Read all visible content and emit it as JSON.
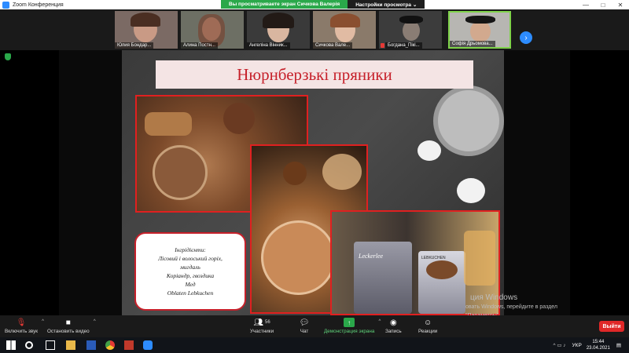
{
  "window": {
    "title": "Zoom Конференция",
    "minimize": "—",
    "maximize": "□",
    "close": "✕"
  },
  "share_banner": {
    "message": "Вы просматриваете экран Сичкова Валерія",
    "options_label": "Настройки просмотра ⌄"
  },
  "participants": [
    {
      "name": "Юлия Бондар..."
    },
    {
      "name": "Алина Постн..."
    },
    {
      "name": "Ангеліна Вінник..."
    },
    {
      "name": "Сичкова Вале..."
    },
    {
      "name": "Богдана_Пікі..."
    },
    {
      "name": "Софія Дрьомова..."
    }
  ],
  "slide": {
    "title": "Нюрнберзькі пряники",
    "ingredients": [
      "Інгрідієнти:",
      "Лісовий і волоський горіх,",
      "мигдаль",
      "Коріандр, гвоздика",
      "Мед",
      "Oblaten Lebkuchen"
    ],
    "tin_label_1": "Leckerlee",
    "tin_label_2": "LEBKUCHEN"
  },
  "watermark": {
    "line1": "ция Windows",
    "line2": "овать Windows, перейдите в раздел",
    "line3": "\"Параметры\"."
  },
  "controls": {
    "unmute": "Включить звук",
    "start_video": "Остановить видео",
    "participants": "Участники",
    "participants_count": "56",
    "chat": "Чат",
    "share_screen": "Демонстрация экрана",
    "record": "Запись",
    "reactions": "Реакции",
    "leave": "Выйти"
  },
  "taskbar": {
    "lang": "УКР",
    "time": "15:44",
    "date": "23.04.2021"
  },
  "colors": {
    "accent": "#2d8cff",
    "share_green": "#2aa84a",
    "leave_red": "#e02828",
    "title_red": "#c6202a"
  }
}
